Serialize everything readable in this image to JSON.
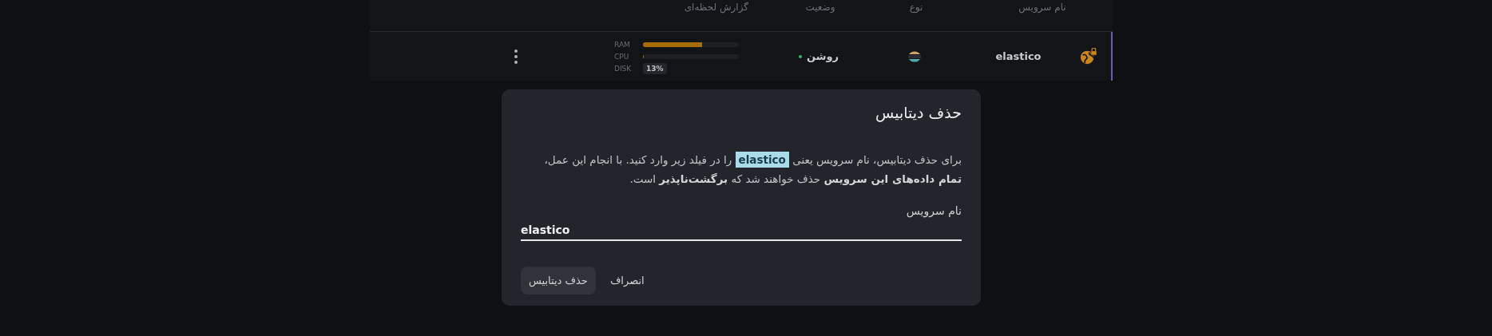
{
  "table": {
    "columns": [
      "نام سرویس",
      "نوع",
      "وضعیت",
      "گزارش لحظه‌ای"
    ],
    "rows": [
      {
        "name": "elastico",
        "status": "روشن",
        "status_on": true,
        "metrics": [
          {
            "kind": "bar",
            "label": "RAM",
            "level": 0.62
          },
          {
            "kind": "bar",
            "label": "CPU",
            "level": 0.01
          },
          {
            "kind": "badge",
            "label": "DISK",
            "value": "13%"
          }
        ]
      }
    ]
  },
  "dialog": {
    "title": "حذف دیتابیس",
    "message": [
      {
        "kind": "text",
        "text": "برای حذف دیتابیس، نام سرویس یعنی "
      },
      {
        "kind": "code",
        "text": "elastico"
      },
      {
        "kind": "text",
        "text": " را در فیلد زیر وارد کنید. با انجام این عمل، "
      },
      {
        "kind": "bold",
        "text": "تمام داده‌های این سرویس"
      },
      {
        "kind": "text",
        "text": " حذف خواهند شد که "
      },
      {
        "kind": "bold",
        "text": "برگشت‌ناپذیر"
      },
      {
        "kind": "text",
        "text": " است."
      }
    ],
    "field_label": "نام سرویس",
    "field_value": "elastico",
    "buttons": [
      {
        "label": "انصراف",
        "kind": "text"
      },
      {
        "label": "حذف دیتابیس",
        "kind": "filled"
      }
    ]
  }
}
